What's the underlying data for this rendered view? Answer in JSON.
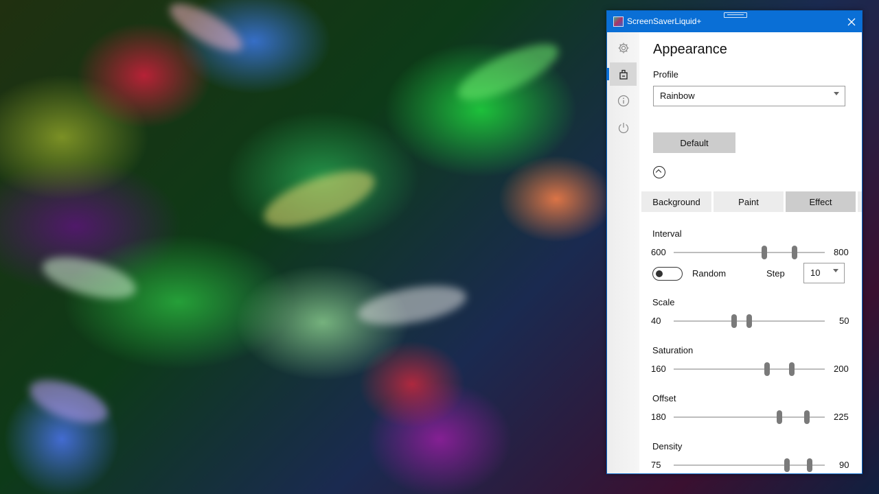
{
  "window": {
    "title": "ScreenSaverLiquid+"
  },
  "nav": [
    {
      "icon": "gear-icon"
    },
    {
      "icon": "paint-bucket-icon",
      "active": true
    },
    {
      "icon": "info-icon"
    },
    {
      "icon": "power-icon"
    }
  ],
  "page": {
    "title": "Appearance",
    "profile_label": "Profile",
    "profile_value": "Rainbow",
    "default_button": "Default"
  },
  "tabs": [
    {
      "label": "Background"
    },
    {
      "label": "Paint"
    },
    {
      "label": "Effect",
      "active": true
    }
  ],
  "interval": {
    "label": "Interval",
    "min_label": "600",
    "max_label": "800",
    "low": 0.6,
    "high": 0.8
  },
  "random": {
    "label": "Random",
    "on": false,
    "step_label": "Step",
    "step_value": "10"
  },
  "scale": {
    "label": "Scale",
    "min_label": "40",
    "max_label": "50",
    "low": 0.4,
    "high": 0.5
  },
  "saturation": {
    "label": "Saturation",
    "min_label": "160",
    "max_label": "200",
    "low": 0.62,
    "high": 0.78
  },
  "offset": {
    "label": "Offset",
    "min_label": "180",
    "max_label": "225",
    "low": 0.7,
    "high": 0.88
  },
  "density": {
    "label": "Density",
    "min_label": "75",
    "max_label": "90",
    "low": 0.75,
    "high": 0.9
  },
  "colors": {
    "accent": "#0a6fd6",
    "active_tab": "#cccccc",
    "thumb": "#7a7a7a"
  }
}
